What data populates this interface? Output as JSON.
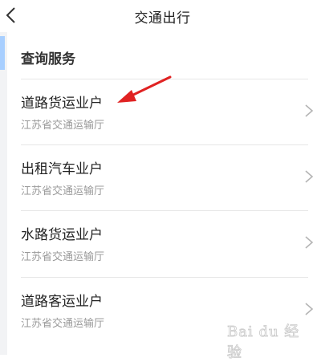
{
  "header": {
    "title": "交通出行",
    "back_icon": "chevron-left-icon"
  },
  "section": {
    "title": "查询服务"
  },
  "items": [
    {
      "title": "道路货运业户",
      "subtitle": "江苏省交通运输厅"
    },
    {
      "title": "出租汽车业户",
      "subtitle": "江苏省交通运输厅"
    },
    {
      "title": "水路货运业户",
      "subtitle": "江苏省交通运输厅"
    },
    {
      "title": "道路客运业户",
      "subtitle": "江苏省交通运输厅"
    }
  ],
  "annotation": {
    "color": "#e02222"
  },
  "watermark": {
    "text": "Bai du 经验"
  },
  "colors": {
    "accent": "#a8cfff",
    "divider": "#e6e6e6",
    "subtitle": "#9a9a9a"
  }
}
